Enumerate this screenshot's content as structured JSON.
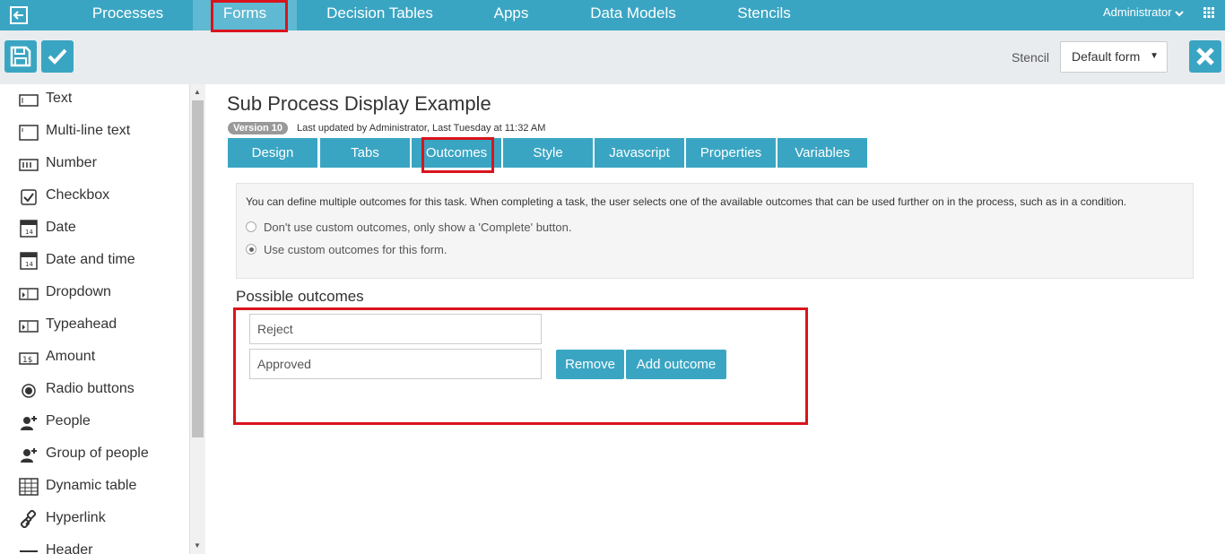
{
  "nav": {
    "items": [
      "Processes",
      "Forms",
      "Decision Tables",
      "Apps",
      "Data Models",
      "Stencils"
    ],
    "user": "Administrator"
  },
  "toolbar": {
    "stencil_label": "Stencil",
    "stencil_value": "Default form"
  },
  "palette": [
    {
      "label": "Text",
      "icon": "text-field-icon"
    },
    {
      "label": "Multi-line text",
      "icon": "multiline-text-icon"
    },
    {
      "label": "Number",
      "icon": "number-icon"
    },
    {
      "label": "Checkbox",
      "icon": "checkbox-icon"
    },
    {
      "label": "Date",
      "icon": "date-icon"
    },
    {
      "label": "Date and time",
      "icon": "date-time-icon"
    },
    {
      "label": "Dropdown",
      "icon": "dropdown-icon"
    },
    {
      "label": "Typeahead",
      "icon": "typeahead-icon"
    },
    {
      "label": "Amount",
      "icon": "amount-icon"
    },
    {
      "label": "Radio buttons",
      "icon": "radio-icon"
    },
    {
      "label": "People",
      "icon": "people-icon"
    },
    {
      "label": "Group of people",
      "icon": "group-icon"
    },
    {
      "label": "Dynamic table",
      "icon": "table-icon"
    },
    {
      "label": "Hyperlink",
      "icon": "link-icon"
    },
    {
      "label": "Header",
      "icon": "header-icon"
    }
  ],
  "form": {
    "title": "Sub Process Display Example",
    "version": "Version 10",
    "updated": "Last updated by Administrator, Last Tuesday at 11:32 AM",
    "tabs": [
      "Design",
      "Tabs",
      "Outcomes",
      "Style",
      "Javascript",
      "Properties",
      "Variables"
    ]
  },
  "outcomes": {
    "description": "You can define multiple outcomes for this task. When completing a task, the user selects one of the available outcomes that can be used further on in the process, such as in a condition.",
    "option_default": "Don't use custom outcomes, only show a 'Complete' button.",
    "option_custom": "Use custom outcomes for this form.",
    "heading": "Possible outcomes",
    "values": [
      "Reject",
      "Approved"
    ],
    "remove_label": "Remove",
    "add_label": "Add outcome"
  },
  "colors": {
    "accent": "#3aa5c3",
    "highlight": "#d9141d"
  }
}
